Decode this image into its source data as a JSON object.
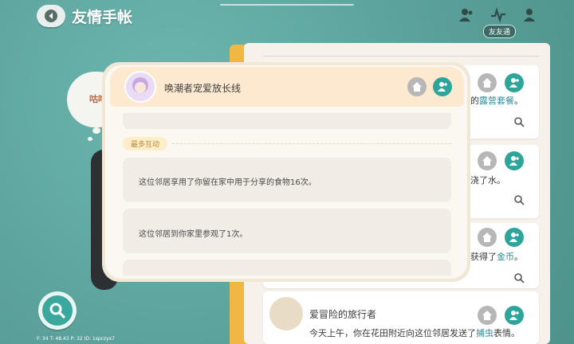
{
  "header": {
    "title": "友情手帐",
    "tab_chip": "友友通"
  },
  "left": {
    "bubble_text": "咕咕"
  },
  "list": {
    "cards": [
      {
        "text_before": "",
        "text_highlight": "露营套餐",
        "text_prefix": "的",
        "text_after": "。"
      },
      {
        "text_before": "浇了水。",
        "text_highlight": "",
        "text_prefix": "",
        "text_after": ""
      },
      {
        "text_before": "获得了",
        "text_highlight": "金币",
        "text_prefix": "",
        "text_after": "。"
      },
      {
        "name": "爱冒险的旅行者",
        "text_before": "今天上午，你在花田附近向这位邻居发送了",
        "text_highlight": "捕虫",
        "text_after": "表情。"
      }
    ]
  },
  "modal": {
    "name": "唤潮者宠爱放长线",
    "section_label": "最多互动",
    "interactions": [
      "这位邻居享用了你留在家中用于分享的食物16次。",
      "这位邻居到你家里参观了1次。"
    ]
  },
  "debug": "F: 34    T: 48.43    P: 32    ID: 1spczyx7",
  "colors": {
    "accent_teal": "#2ea59a",
    "highlight": "#2f8f99",
    "modal_header": "#fde9cf",
    "panel_edge": "#f0b842"
  },
  "icons": [
    "back-arrow-icon",
    "friends-icon",
    "activity-icon",
    "friend-add-icon",
    "home-icon",
    "add-friend-icon",
    "zoom-icon",
    "search-icon"
  ]
}
